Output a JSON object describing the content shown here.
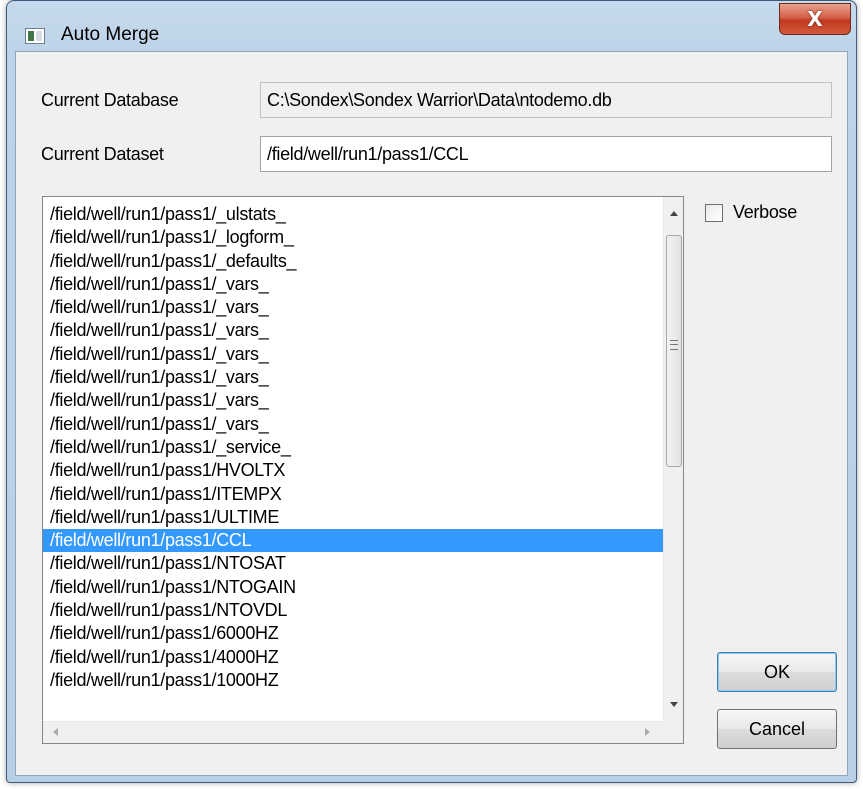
{
  "window": {
    "title": "Auto Merge",
    "close_glyph": "X"
  },
  "form": {
    "database_label": "Current Database",
    "database_value": "C:\\Sondex\\Sondex Warrior\\Data\\ntodemo.db",
    "dataset_label": "Current Dataset",
    "dataset_value": "/field/well/run1/pass1/CCL"
  },
  "list": {
    "selected_index": 14,
    "items": [
      "/field/well/run1/pass1/_ulstats_",
      "/field/well/run1/pass1/_logform_",
      "/field/well/run1/pass1/_defaults_",
      "/field/well/run1/pass1/_vars_",
      "/field/well/run1/pass1/_vars_",
      "/field/well/run1/pass1/_vars_",
      "/field/well/run1/pass1/_vars_",
      "/field/well/run1/pass1/_vars_",
      "/field/well/run1/pass1/_vars_",
      "/field/well/run1/pass1/_vars_",
      "/field/well/run1/pass1/_service_",
      "/field/well/run1/pass1/HVOLTX",
      "/field/well/run1/pass1/ITEMPX",
      "/field/well/run1/pass1/ULTIME",
      "/field/well/run1/pass1/CCL",
      "/field/well/run1/pass1/NTOSAT",
      "/field/well/run1/pass1/NTOGAIN",
      "/field/well/run1/pass1/NTOVDL",
      "/field/well/run1/pass1/6000HZ",
      "/field/well/run1/pass1/4000HZ",
      "/field/well/run1/pass1/1000HZ"
    ]
  },
  "options": {
    "verbose_label": "Verbose",
    "verbose_checked": false
  },
  "buttons": {
    "ok": "OK",
    "cancel": "Cancel"
  },
  "colors": {
    "selection": "#3399ff",
    "close_button": "#c8452c",
    "frame": "#bed3e8"
  },
  "icons": [
    "app-icon",
    "close-icon",
    "scroll-up-icon",
    "scroll-down-icon",
    "scroll-left-icon",
    "scroll-right-icon",
    "scroll-grip-icon"
  ]
}
